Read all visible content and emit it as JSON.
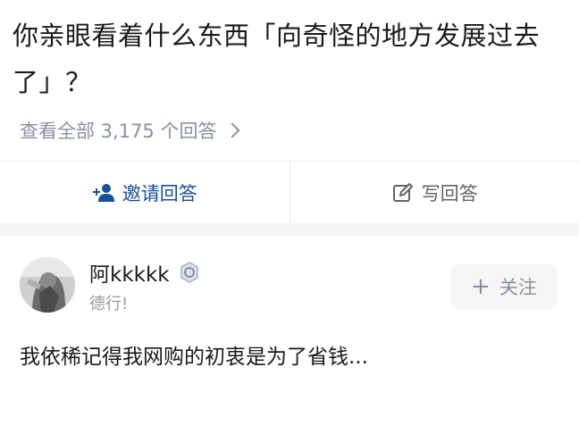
{
  "question": {
    "title": "你亲眼看着什么东西「向奇怪的地方发展过去了」？"
  },
  "view_all": {
    "label": "查看全部 3,175 个回答"
  },
  "actions": {
    "invite_label": "邀请回答",
    "write_label": "写回答"
  },
  "answer": {
    "author_name": "阿kkkkk",
    "author_bio": "德行!",
    "follow_label": "关注",
    "content": "我依稀记得我网购的初衷是为了省钱..."
  },
  "icons": {
    "invite": "add-person-icon",
    "write": "edit-icon",
    "badge": "verified-badge-icon",
    "chevron": "chevron-right-icon",
    "plus": "plus-icon"
  },
  "colors": {
    "link_blue": "#175199",
    "muted_gray": "#8590a6",
    "text_dark": "#1a1a1a"
  }
}
